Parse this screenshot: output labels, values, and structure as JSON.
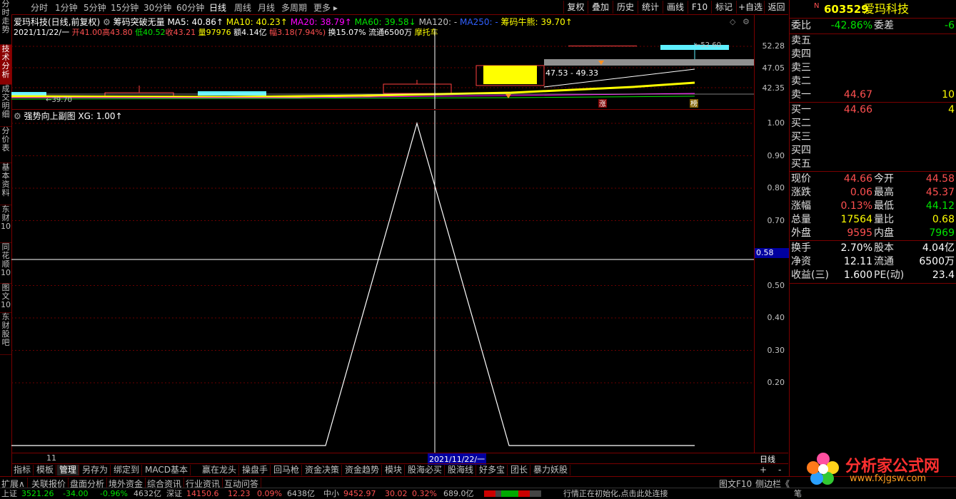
{
  "left_tabs": [
    "分时走势",
    "技术分析",
    "成交明细",
    "分价表",
    "基本资料",
    "东财10",
    "同花顺10",
    "图文10",
    "东财股吧"
  ],
  "periods": [
    "分时",
    "1分钟",
    "5分钟",
    "15分钟",
    "30分钟",
    "60分钟",
    "日线",
    "周线",
    "月线",
    "多周期",
    "更多"
  ],
  "active_period": "日线",
  "toolbar": [
    "复权",
    "叠加",
    "历史",
    "统计",
    "画线",
    "F10",
    "标记",
    "+自选",
    "返回"
  ],
  "chart_header": {
    "name": "爱玛科技(日线,前复权)",
    "indicator": "筹码突破无量",
    "ma5": "MA5: 40.86↑",
    "ma10": "MA10: 40.23↑",
    "ma20": "MA20: 38.79↑",
    "ma60": "MA60: 39.58↓",
    "ma120": "MA120: -",
    "ma250": "MA250: -",
    "chip": "筹码牛熊: 39.70↑",
    "colors": {
      "ma5": "#ffffff",
      "ma10": "#ffff00",
      "ma20": "#ff00ff",
      "ma60": "#00e600",
      "ma120": "#c0c0c0",
      "ma250": "#3060ff",
      "chip": "#ffff00"
    }
  },
  "bar_info": {
    "date": "2021/11/22/一",
    "open": "开41.00",
    "high": "高43.80",
    "low": "低40.52",
    "close": "收43.21",
    "volume": "量97976",
    "amount": "额4.14亿",
    "range": "幅3.18(7.94%)",
    "turnover": "换15.07%",
    "float": "流通6500万",
    "theme": "摩托车"
  },
  "main_chart": {
    "price_labels": [
      "52.28",
      "47.05",
      "42.35"
    ],
    "annot_high": "52.60",
    "annot_low": "39.70",
    "range_label": "47.53 - 49.33",
    "badge_up": "涨",
    "badge_rank": "榜"
  },
  "sub_chart": {
    "title": "强势向上副图 XG: 1.00↑",
    "y_labels": [
      "1.00",
      "0.90",
      "0.80",
      "0.70",
      "0.50",
      "0.40",
      "0.30",
      "0.20"
    ],
    "cursor_value": "0.58",
    "xg_series": [
      0,
      0,
      1,
      0,
      0,
      0
    ]
  },
  "x_axis": {
    "left_label": "11",
    "cursor_date": "2021/11/22/一",
    "period_label": "日线"
  },
  "bottom_tabs": [
    "指标",
    "模板",
    "管理",
    "另存为",
    "绑定到",
    "MACD基本",
    "赢在龙头",
    "操盘手",
    "回马枪",
    "资金决策",
    "资金趋势",
    "模块",
    "股海必买",
    "股海线",
    "好多宝",
    "团长",
    "暴力妖股"
  ],
  "active_bottom_tab": "管理",
  "bottom_row": [
    "扩展∧",
    "关联报价",
    "盘面分析",
    "境外资金",
    "综合资讯",
    "行业资讯",
    "互动问答"
  ],
  "bottom_right": [
    "图文F10",
    "侧边栏《"
  ],
  "status": {
    "sh_label": "上证",
    "sh_value": "3521.26",
    "sh_change": "-34.00",
    "sh_pct": "-0.96%",
    "sh_amount": "4632亿",
    "sz_label": "深证",
    "sz_value": "14150.6",
    "sz_change": "12.23",
    "sz_pct": "0.09%",
    "sz_amount": "6438亿",
    "zx_label": "中小",
    "zx_value": "9452.97",
    "zx_change": "30.02",
    "zx_pct": "0.32%",
    "zx_amount": "689.0亿",
    "message": "行情正在初始化,点击此处连接",
    "extra": "笔"
  },
  "right_panel": {
    "code": "603529",
    "name": "爱玛科技",
    "badge": "N",
    "weibi_label": "委比",
    "weibi": "-42.86%",
    "weicha_label": "委差",
    "weicha": "-6",
    "asks": [
      {
        "label": "卖五",
        "price": "",
        "vol": ""
      },
      {
        "label": "卖四",
        "price": "",
        "vol": ""
      },
      {
        "label": "卖三",
        "price": "",
        "vol": ""
      },
      {
        "label": "卖二",
        "price": "",
        "vol": ""
      },
      {
        "label": "卖一",
        "price": "44.67",
        "vol": "10"
      }
    ],
    "bids": [
      {
        "label": "买一",
        "price": "44.66",
        "vol": "4"
      },
      {
        "label": "买二",
        "price": "",
        "vol": ""
      },
      {
        "label": "买三",
        "price": "",
        "vol": ""
      },
      {
        "label": "买四",
        "price": "",
        "vol": ""
      },
      {
        "label": "买五",
        "price": "",
        "vol": ""
      }
    ],
    "quote": [
      {
        "l1": "现价",
        "v1": "44.66",
        "c1": "red",
        "l2": "今开",
        "v2": "44.58",
        "c2": "red"
      },
      {
        "l1": "涨跌",
        "v1": "0.06",
        "c1": "red",
        "l2": "最高",
        "v2": "45.37",
        "c2": "red"
      },
      {
        "l1": "涨幅",
        "v1": "0.13%",
        "c1": "red",
        "l2": "最低",
        "v2": "44.12",
        "c2": "green"
      },
      {
        "l1": "总量",
        "v1": "17564",
        "c1": "yellow",
        "l2": "量比",
        "v2": "0.68",
        "c2": "yellow"
      },
      {
        "l1": "外盘",
        "v1": "9595",
        "c1": "red",
        "l2": "内盘",
        "v2": "7969",
        "c2": "green"
      }
    ],
    "fund": [
      {
        "l1": "换手",
        "v1": "2.70%",
        "l2": "股本",
        "v2": "4.04亿"
      },
      {
        "l1": "净资",
        "v1": "12.11",
        "l2": "流通",
        "v2": "6500万"
      },
      {
        "l1": "收益(三)",
        "v1": "1.600",
        "l2": "PE(动)",
        "v2": "23.4"
      }
    ]
  },
  "watermark": {
    "title": "分析家公式网",
    "url": "www.fxjgsw.com"
  }
}
